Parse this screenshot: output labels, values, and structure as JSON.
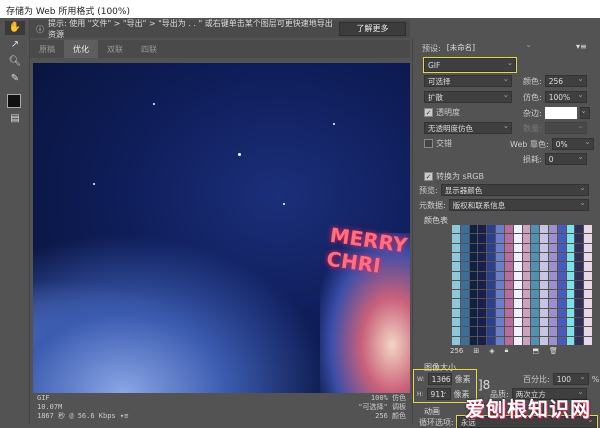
{
  "window": {
    "title": "存储为 Web 所用格式 (100%)"
  },
  "hint": {
    "text": "提示:  使用 \"文件\" > \"导出\" > \"导出为 . . \" 或右键单击某个图层可更快速地导出资源",
    "learn_more": "了解更多"
  },
  "tabs": [
    {
      "label": "原稿"
    },
    {
      "label": "优化"
    },
    {
      "label": "双联"
    },
    {
      "label": "四联"
    }
  ],
  "status": {
    "format": "GIF",
    "size": "10.07M",
    "time": "1867 秒 @ 56.6 Kbps",
    "dither": "100% 仿色",
    "palette": "\"可选择\" 调板",
    "colors": "256 颜色"
  },
  "settings": {
    "preset_label": "预设:",
    "preset_value": "[未命名]",
    "format": "GIF",
    "reduction": "可选择",
    "colors_label": "颜色:",
    "colors_value": "256",
    "dither_algo": "扩散",
    "dither_label": "仿色:",
    "dither_value": "100%",
    "transparency_label": "透明度",
    "transparency_checked": true,
    "matte_label": "杂边:",
    "trans_dither": "无透明度仿色",
    "amount_label": "数量:",
    "interlaced_label": "交错",
    "interlaced_checked": false,
    "web_snap_label": "Web 靠色:",
    "web_snap_value": "0%",
    "lossy_label": "损耗:",
    "lossy_value": "0",
    "srgb_label": "转换为 sRGB",
    "srgb_checked": true,
    "preview_label": "预览:",
    "preview_value": "显示器颜色",
    "metadata_label": "元数据:",
    "metadata_value": "版权和联系信息"
  },
  "color_table": {
    "title": "颜色表",
    "count": "256"
  },
  "image_size": {
    "title": "图像大小",
    "w_label": "W:",
    "w_value": "1366",
    "h_label": "H:",
    "h_value": "911",
    "unit": "像素",
    "percent_label": "百分比:",
    "percent_value": "100",
    "percent_unit": "%",
    "quality_label": "品质:",
    "quality_value": "两次立方"
  },
  "animation": {
    "title": "动画",
    "loop_label": "循环选项:",
    "loop_value": "永远"
  },
  "watermark": "爱刨根知识网"
}
